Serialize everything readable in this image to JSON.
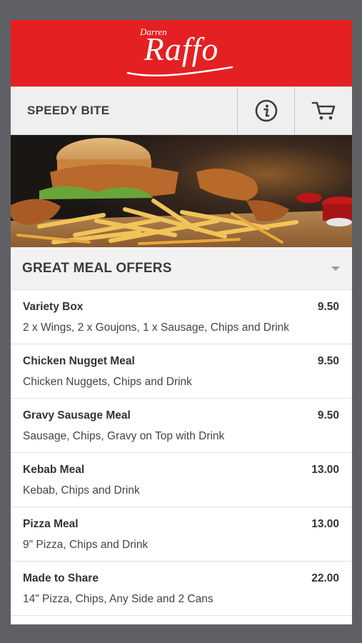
{
  "brand": {
    "first_name": "Darren",
    "name": "Raffo"
  },
  "nav": {
    "title": "SPEEDY BITE",
    "info_icon": "info-icon",
    "cart_icon": "cart-icon"
  },
  "hero": {
    "description": "burger-chips-goujons-photo"
  },
  "section": {
    "title": "GREAT MEAL OFFERS",
    "toggle_icon": "caret-down-icon"
  },
  "items": [
    {
      "name": "Variety Box",
      "price": "9.50",
      "description": "2 x Wings, 2 x Goujons, 1 x Sausage, Chips and Drink"
    },
    {
      "name": "Chicken Nugget Meal",
      "price": "9.50",
      "description": "Chicken Nuggets, Chips and Drink"
    },
    {
      "name": "Gravy Sausage Meal",
      "price": "9.50",
      "description": "Sausage, Chips, Gravy on Top with Drink"
    },
    {
      "name": "Kebab Meal",
      "price": "13.00",
      "description": "Kebab, Chips and Drink"
    },
    {
      "name": "Pizza Meal",
      "price": "13.00",
      "description": "9\" Pizza, Chips and Drink"
    },
    {
      "name": "Made to Share",
      "price": "22.00",
      "description": "14\" Pizza, Chips, Any Side and 2 Cans"
    }
  ],
  "colors": {
    "brand_red": "#e42022",
    "backdrop": "#5e6064",
    "header_gray": "#eeeeee"
  }
}
